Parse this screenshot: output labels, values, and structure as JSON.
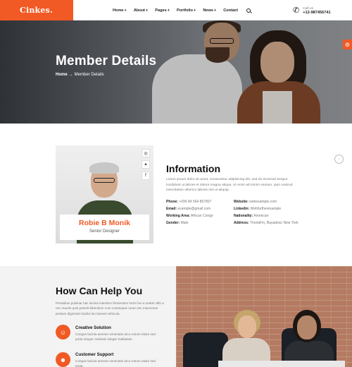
{
  "brand": {
    "logo": "Cinkes.",
    "accent": "#f15a24"
  },
  "nav": {
    "items": [
      {
        "label": "Home",
        "plus": "+"
      },
      {
        "label": "About",
        "plus": "+"
      },
      {
        "label": "Pages",
        "plus": "+"
      },
      {
        "label": "Portfolio",
        "plus": "+"
      },
      {
        "label": "News",
        "plus": "+"
      },
      {
        "label": "Contact",
        "plus": ""
      }
    ],
    "search_icon": "search-icon"
  },
  "call": {
    "label": "Call Us",
    "number": "+12-987456741",
    "icon": "phone-icon"
  },
  "hero": {
    "title": "Member Details",
    "breadcrumb": {
      "home": "Home",
      "sep": "→",
      "current": "Member Details"
    },
    "settings_icon": "gear-icon"
  },
  "member": {
    "name": "Robie B Monik",
    "role": "Senior Designer",
    "socials": [
      "instagram-icon",
      "twitter-icon",
      "facebook-icon"
    ]
  },
  "info": {
    "title": "Information",
    "description": "Lorem ipsum dolor sit amet, consectetur adipisicing elit, sed do eiusmod tempor incididunt ut labore et dolore magna aliqua. Ut enim ad minim veniam, quis nostrud exercitation ullamco laboris nisi ut aliquip.",
    "left": [
      {
        "label": "Phone:",
        "value": "+096 84 564 867807"
      },
      {
        "label": "Email:",
        "value": "example@gmail.com"
      },
      {
        "label": "Working Area:",
        "value": "African Congo"
      },
      {
        "label": "Gender:",
        "value": "Male"
      }
    ],
    "right": [
      {
        "label": "Website:",
        "value": "webexample.com"
      },
      {
        "label": "Linkedin:",
        "value": "Webfurtherexample"
      },
      {
        "label": "Nationality:",
        "value": "American"
      },
      {
        "label": "Address:",
        "value": "TheriaFin, Bayadeal, New York"
      }
    ]
  },
  "help": {
    "title": "How Can Help You",
    "description": "Penatibus pulvinar hac lacinia interdum fermentum tortor leo a mattis nibh a nec mauris quis potenti bibendum cum consequat curae nec maecenas pretium dignissim facilisi leo laoreet vehicula.",
    "services": [
      {
        "title": "Creative Solution",
        "desc": "Congue lacinia aenean venenatis arcu rutrum etiam sed porta integer molestie integer habitasse.",
        "icon": "user-share-icon"
      },
      {
        "title": "Customer Support",
        "desc": "Congue lacinia aenean venenatis arcu rutrum etiam sed porta.",
        "icon": "user-icon"
      }
    ]
  }
}
